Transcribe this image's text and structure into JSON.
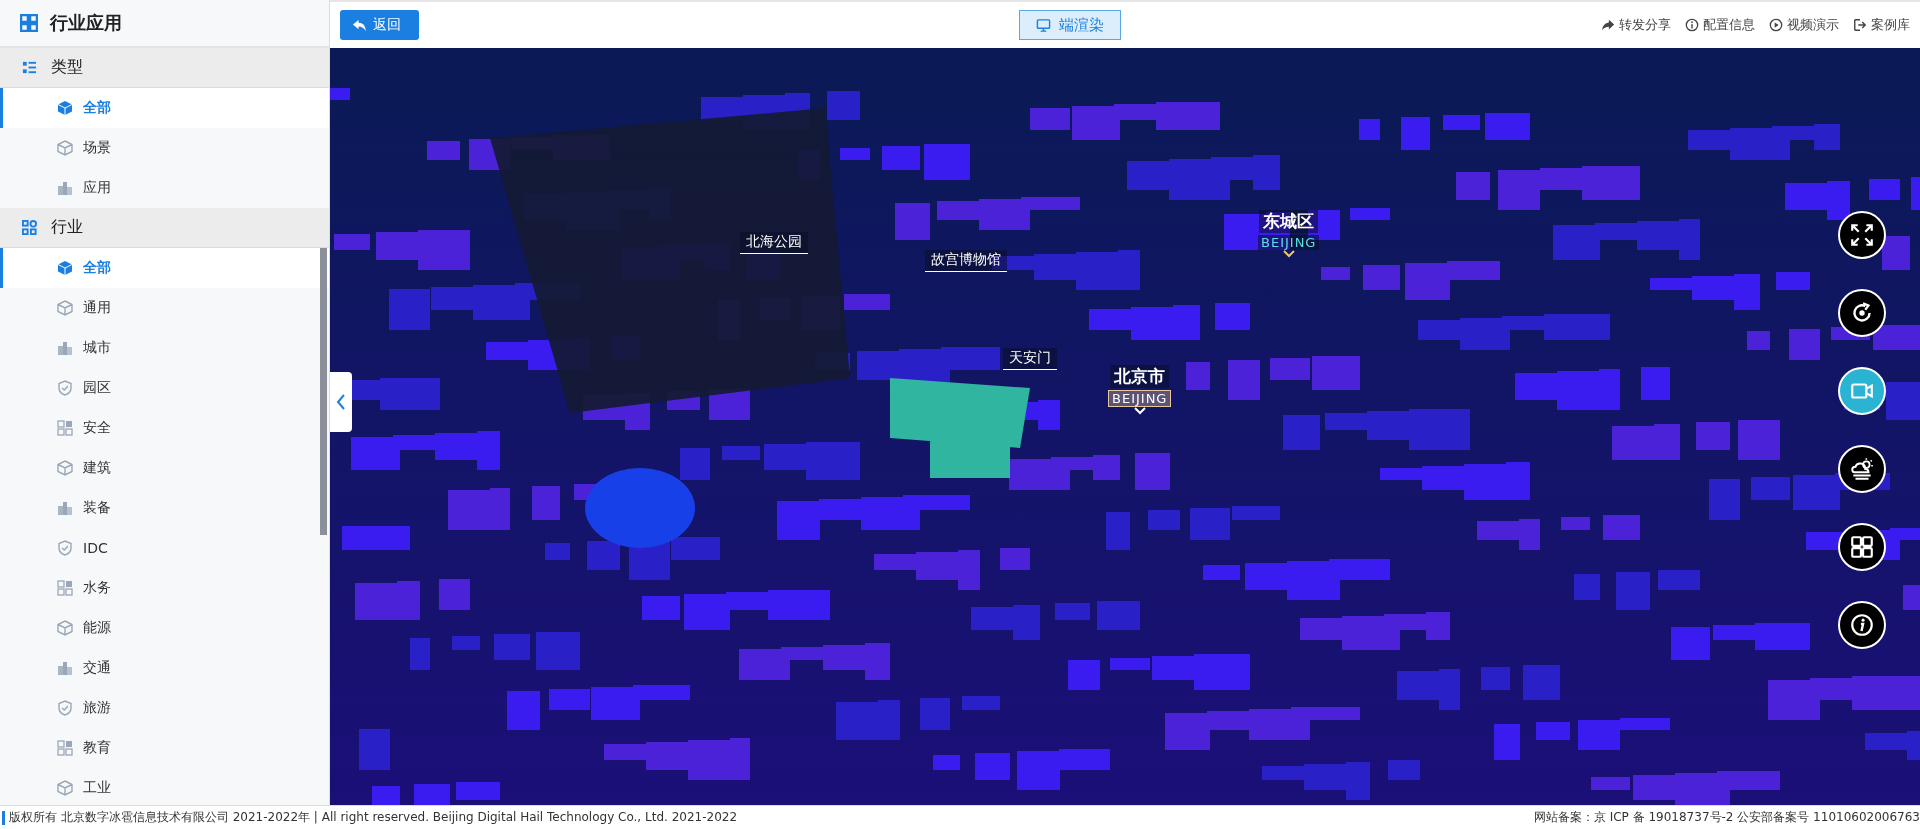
{
  "sidebar": {
    "title": "行业应用",
    "sections": [
      {
        "title": "类型",
        "items": [
          {
            "label": "全部",
            "selected": true
          },
          {
            "label": "场景",
            "selected": false
          },
          {
            "label": "应用",
            "selected": false
          }
        ]
      },
      {
        "title": "行业",
        "items": [
          {
            "label": "全部",
            "selected": true
          },
          {
            "label": "通用",
            "selected": false
          },
          {
            "label": "城市",
            "selected": false
          },
          {
            "label": "园区",
            "selected": false
          },
          {
            "label": "安全",
            "selected": false
          },
          {
            "label": "建筑",
            "selected": false
          },
          {
            "label": "装备",
            "selected": false
          },
          {
            "label": "IDC",
            "selected": false
          },
          {
            "label": "水务",
            "selected": false
          },
          {
            "label": "能源",
            "selected": false
          },
          {
            "label": "交通",
            "selected": false
          },
          {
            "label": "旅游",
            "selected": false
          },
          {
            "label": "教育",
            "selected": false
          },
          {
            "label": "工业",
            "selected": false
          }
        ]
      }
    ]
  },
  "toolbar": {
    "back_button": "返回",
    "render_toggle": {
      "label": "端渲染",
      "selected": true
    },
    "links": [
      "转发分享",
      "配置信息",
      "视频演示",
      "案例库"
    ]
  },
  "map": {
    "labels": [
      {
        "kind": "poi",
        "text": "北海公园"
      },
      {
        "kind": "poi",
        "text": "故宫博物馆"
      },
      {
        "kind": "poi",
        "text": "天安门"
      },
      {
        "kind": "city",
        "text": "北京市",
        "subtitle": "BEIJING"
      },
      {
        "kind": "district",
        "text": "东城区",
        "subtitle": "BEIJING"
      }
    ],
    "controls": [
      {
        "selected": false
      },
      {
        "selected": false
      },
      {
        "selected": true
      },
      {
        "selected": false
      },
      {
        "selected": false
      },
      {
        "selected": false
      }
    ]
  },
  "footer": {
    "copyright": "版权所有 北京数字冰雹信息技术有限公司 2021-2022年 | All right reserved. Beijing Digital Hail Technology Co., Ltd. 2021-2022",
    "filing": "网站备案：京 ICP 备 19018737号-2 公安部备案号 11010602006763"
  }
}
